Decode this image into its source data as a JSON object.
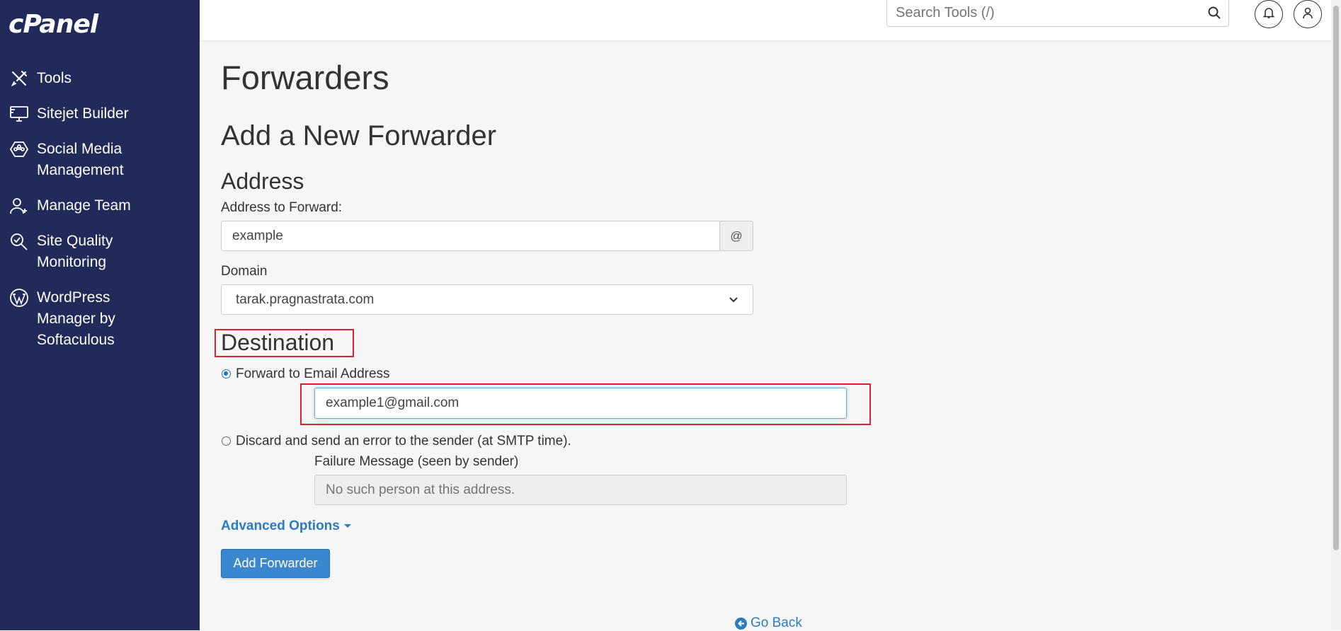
{
  "brand": {
    "logo": "cPanel"
  },
  "sidebar": {
    "items": [
      {
        "label": "Tools",
        "icon": "tools-icon"
      },
      {
        "label": "Sitejet Builder",
        "icon": "monitor-icon"
      },
      {
        "label": "Social Media\nManagement",
        "icon": "social-network-icon"
      },
      {
        "label": "Manage Team",
        "icon": "user-plus-icon"
      },
      {
        "label": "Site Quality\nMonitoring",
        "icon": "search-check-icon"
      },
      {
        "label": "WordPress\nManager by\nSoftaculous",
        "icon": "wordpress-icon"
      }
    ]
  },
  "header": {
    "search_placeholder": "Search Tools (/)",
    "search_icon": "search-icon",
    "notifications_icon": "bell-icon",
    "user_icon": "user-icon"
  },
  "page": {
    "title": "Forwarders",
    "section_title": "Add a New Forwarder",
    "address_heading": "Address",
    "address_label": "Address to Forward:",
    "address_value": "example",
    "address_addon": "@",
    "domain_label": "Domain",
    "domain_value": "tarak.pragnastrata.com",
    "destination_heading": "Destination",
    "forward_option_label": "Forward to Email Address",
    "forward_selected": true,
    "forward_value": "example1@gmail.com",
    "discard_option_label": "Discard and send an error to the sender (at SMTP time).",
    "failure_label": "Failure Message (seen by sender)",
    "failure_placeholder": "No such person at this address.",
    "advanced_options": "Advanced Options",
    "submit_label": "Add Forwarder",
    "go_back": "Go Back"
  },
  "colors": {
    "sidebar_bg": "#222a5a",
    "accent": "#3b87cf",
    "highlight": "#d9232e"
  }
}
